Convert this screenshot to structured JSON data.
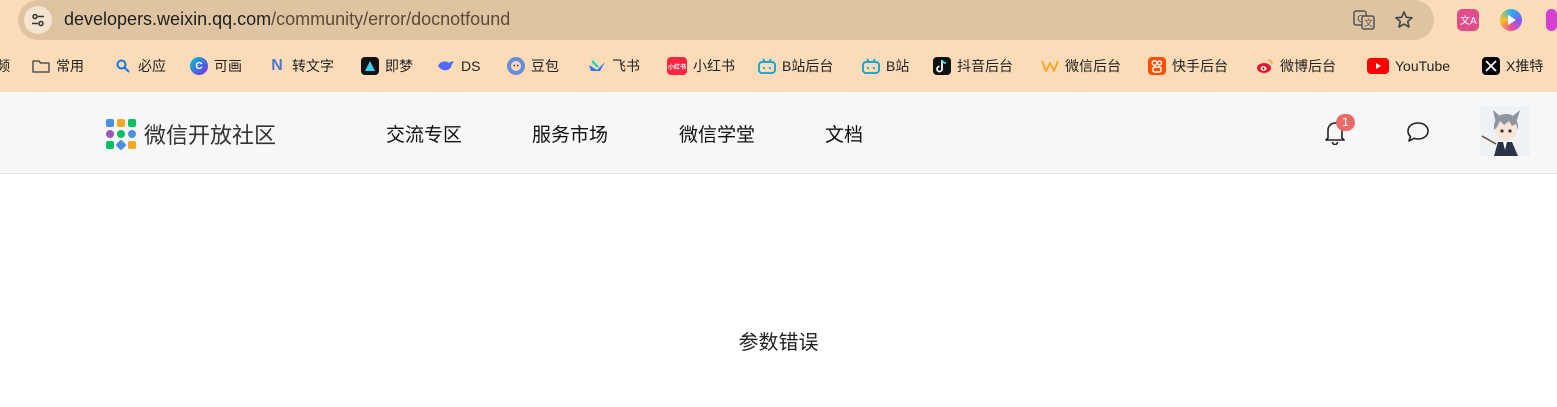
{
  "browser": {
    "url_host": "developers.weixin.qq.com",
    "url_path": "/community/error/docnotfound",
    "bookmarks_leading_fragment": "频",
    "bookmarks": [
      {
        "label": "常用",
        "icon": "folder-icon",
        "color": "#555555"
      },
      {
        "label": "必应",
        "icon": "bing-search-icon",
        "color": "#1a73e8"
      },
      {
        "label": "可画",
        "icon": "canva-icon",
        "color": "#7d2ae8"
      },
      {
        "label": "转文字",
        "icon": "n-icon",
        "color": "#4a7bd0"
      },
      {
        "label": "即梦",
        "icon": "jimeng-icon",
        "color": "#111111"
      },
      {
        "label": "DS",
        "icon": "deepseek-icon",
        "color": "#4d6bfe"
      },
      {
        "label": "豆包",
        "icon": "doubao-icon",
        "color": "#6c8cd5"
      },
      {
        "label": "飞书",
        "icon": "feishu-icon",
        "color": "#3370ff"
      },
      {
        "label": "小红书",
        "icon": "xiaohongshu-icon",
        "color": "#ff2442"
      },
      {
        "label": "B站后台",
        "icon": "bilibili-icon",
        "color": "#00a1d6"
      },
      {
        "label": "B站",
        "icon": "bilibili-icon",
        "color": "#00a1d6"
      },
      {
        "label": "抖音后台",
        "icon": "douyin-icon",
        "color": "#111111"
      },
      {
        "label": "微信后台",
        "icon": "wechat-w-icon",
        "color": "#f5a623"
      },
      {
        "label": "快手后台",
        "icon": "kuaishou-icon",
        "color": "#ff5000"
      },
      {
        "label": "微博后台",
        "icon": "weibo-icon",
        "color": "#e6162d"
      },
      {
        "label": "YouTube",
        "icon": "youtube-icon",
        "color": "#ff0000"
      },
      {
        "label": "X推特",
        "icon": "x-icon",
        "color": "#000000"
      }
    ]
  },
  "header": {
    "logo_text": "微信开放社区",
    "nav": [
      "交流专区",
      "服务市场",
      "微信学堂",
      "文档"
    ],
    "notification_count": "1"
  },
  "main": {
    "error_message": "参数错误"
  }
}
